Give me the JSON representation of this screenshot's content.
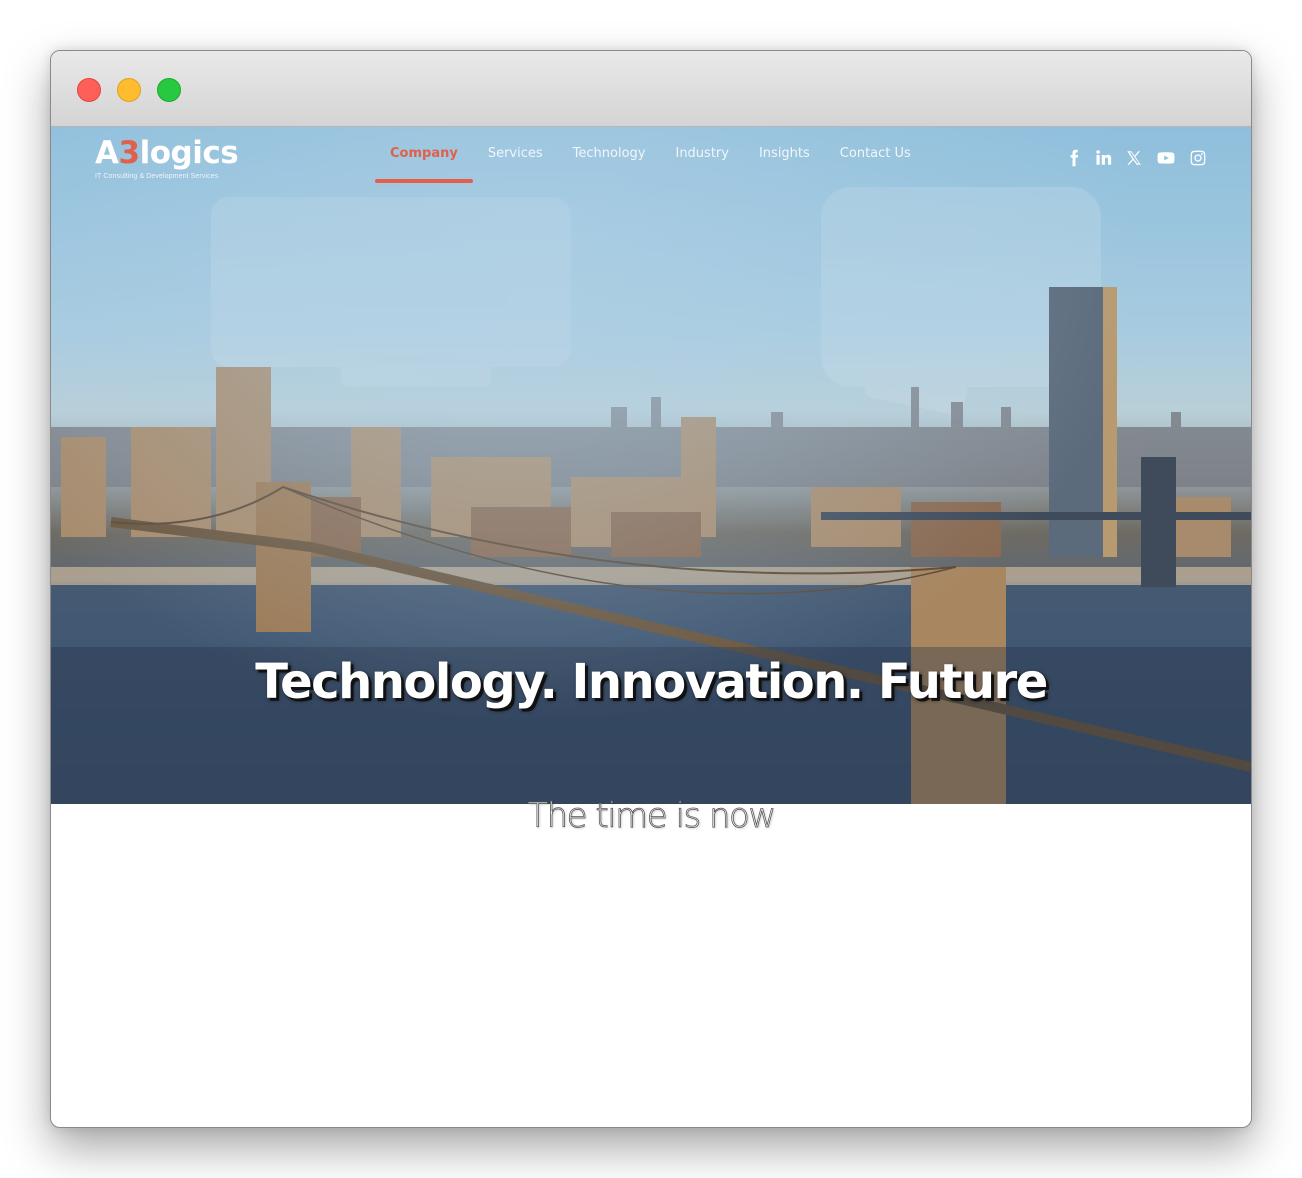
{
  "window": {
    "controls": [
      "close",
      "minimize",
      "maximize"
    ]
  },
  "brand": {
    "logo_prefix": "A",
    "logo_accent": "3",
    "logo_suffix": "logics",
    "tagline": "IT Consulting & Development Services",
    "accent_color": "#e0604a"
  },
  "nav": {
    "items": [
      {
        "label": "Company",
        "active": true
      },
      {
        "label": "Services",
        "active": false
      },
      {
        "label": "Technology",
        "active": false
      },
      {
        "label": "Industry",
        "active": false
      },
      {
        "label": "Insights",
        "active": false
      },
      {
        "label": "Contact Us",
        "active": false
      }
    ]
  },
  "social": [
    {
      "icon": "facebook-icon"
    },
    {
      "icon": "linkedin-icon"
    },
    {
      "icon": "x-twitter-icon"
    },
    {
      "icon": "youtube-icon"
    },
    {
      "icon": "instagram-icon"
    }
  ],
  "hero": {
    "headline": "Technology. Innovation. Future",
    "subheadline": "The time is now",
    "background": "city skyline with bridge overlaid with team working on laptops"
  }
}
